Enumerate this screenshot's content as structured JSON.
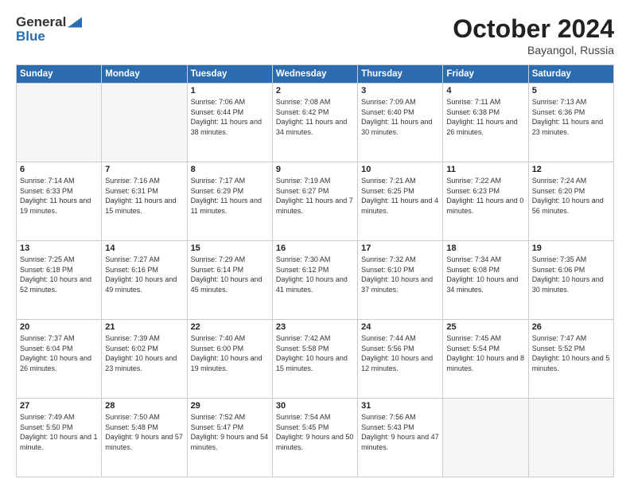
{
  "header": {
    "logo_general": "General",
    "logo_blue": "Blue",
    "month_title": "October 2024",
    "location": "Bayangol, Russia"
  },
  "days_of_week": [
    "Sunday",
    "Monday",
    "Tuesday",
    "Wednesday",
    "Thursday",
    "Friday",
    "Saturday"
  ],
  "weeks": [
    [
      {
        "day": "",
        "empty": true
      },
      {
        "day": "",
        "empty": true
      },
      {
        "day": "1",
        "sunrise": "Sunrise: 7:06 AM",
        "sunset": "Sunset: 6:44 PM",
        "daylight": "Daylight: 11 hours and 38 minutes."
      },
      {
        "day": "2",
        "sunrise": "Sunrise: 7:08 AM",
        "sunset": "Sunset: 6:42 PM",
        "daylight": "Daylight: 11 hours and 34 minutes."
      },
      {
        "day": "3",
        "sunrise": "Sunrise: 7:09 AM",
        "sunset": "Sunset: 6:40 PM",
        "daylight": "Daylight: 11 hours and 30 minutes."
      },
      {
        "day": "4",
        "sunrise": "Sunrise: 7:11 AM",
        "sunset": "Sunset: 6:38 PM",
        "daylight": "Daylight: 11 hours and 26 minutes."
      },
      {
        "day": "5",
        "sunrise": "Sunrise: 7:13 AM",
        "sunset": "Sunset: 6:36 PM",
        "daylight": "Daylight: 11 hours and 23 minutes."
      }
    ],
    [
      {
        "day": "6",
        "sunrise": "Sunrise: 7:14 AM",
        "sunset": "Sunset: 6:33 PM",
        "daylight": "Daylight: 11 hours and 19 minutes."
      },
      {
        "day": "7",
        "sunrise": "Sunrise: 7:16 AM",
        "sunset": "Sunset: 6:31 PM",
        "daylight": "Daylight: 11 hours and 15 minutes."
      },
      {
        "day": "8",
        "sunrise": "Sunrise: 7:17 AM",
        "sunset": "Sunset: 6:29 PM",
        "daylight": "Daylight: 11 hours and 11 minutes."
      },
      {
        "day": "9",
        "sunrise": "Sunrise: 7:19 AM",
        "sunset": "Sunset: 6:27 PM",
        "daylight": "Daylight: 11 hours and 7 minutes."
      },
      {
        "day": "10",
        "sunrise": "Sunrise: 7:21 AM",
        "sunset": "Sunset: 6:25 PM",
        "daylight": "Daylight: 11 hours and 4 minutes."
      },
      {
        "day": "11",
        "sunrise": "Sunrise: 7:22 AM",
        "sunset": "Sunset: 6:23 PM",
        "daylight": "Daylight: 11 hours and 0 minutes."
      },
      {
        "day": "12",
        "sunrise": "Sunrise: 7:24 AM",
        "sunset": "Sunset: 6:20 PM",
        "daylight": "Daylight: 10 hours and 56 minutes."
      }
    ],
    [
      {
        "day": "13",
        "sunrise": "Sunrise: 7:25 AM",
        "sunset": "Sunset: 6:18 PM",
        "daylight": "Daylight: 10 hours and 52 minutes."
      },
      {
        "day": "14",
        "sunrise": "Sunrise: 7:27 AM",
        "sunset": "Sunset: 6:16 PM",
        "daylight": "Daylight: 10 hours and 49 minutes."
      },
      {
        "day": "15",
        "sunrise": "Sunrise: 7:29 AM",
        "sunset": "Sunset: 6:14 PM",
        "daylight": "Daylight: 10 hours and 45 minutes."
      },
      {
        "day": "16",
        "sunrise": "Sunrise: 7:30 AM",
        "sunset": "Sunset: 6:12 PM",
        "daylight": "Daylight: 10 hours and 41 minutes."
      },
      {
        "day": "17",
        "sunrise": "Sunrise: 7:32 AM",
        "sunset": "Sunset: 6:10 PM",
        "daylight": "Daylight: 10 hours and 37 minutes."
      },
      {
        "day": "18",
        "sunrise": "Sunrise: 7:34 AM",
        "sunset": "Sunset: 6:08 PM",
        "daylight": "Daylight: 10 hours and 34 minutes."
      },
      {
        "day": "19",
        "sunrise": "Sunrise: 7:35 AM",
        "sunset": "Sunset: 6:06 PM",
        "daylight": "Daylight: 10 hours and 30 minutes."
      }
    ],
    [
      {
        "day": "20",
        "sunrise": "Sunrise: 7:37 AM",
        "sunset": "Sunset: 6:04 PM",
        "daylight": "Daylight: 10 hours and 26 minutes."
      },
      {
        "day": "21",
        "sunrise": "Sunrise: 7:39 AM",
        "sunset": "Sunset: 6:02 PM",
        "daylight": "Daylight: 10 hours and 23 minutes."
      },
      {
        "day": "22",
        "sunrise": "Sunrise: 7:40 AM",
        "sunset": "Sunset: 6:00 PM",
        "daylight": "Daylight: 10 hours and 19 minutes."
      },
      {
        "day": "23",
        "sunrise": "Sunrise: 7:42 AM",
        "sunset": "Sunset: 5:58 PM",
        "daylight": "Daylight: 10 hours and 15 minutes."
      },
      {
        "day": "24",
        "sunrise": "Sunrise: 7:44 AM",
        "sunset": "Sunset: 5:56 PM",
        "daylight": "Daylight: 10 hours and 12 minutes."
      },
      {
        "day": "25",
        "sunrise": "Sunrise: 7:45 AM",
        "sunset": "Sunset: 5:54 PM",
        "daylight": "Daylight: 10 hours and 8 minutes."
      },
      {
        "day": "26",
        "sunrise": "Sunrise: 7:47 AM",
        "sunset": "Sunset: 5:52 PM",
        "daylight": "Daylight: 10 hours and 5 minutes."
      }
    ],
    [
      {
        "day": "27",
        "sunrise": "Sunrise: 7:49 AM",
        "sunset": "Sunset: 5:50 PM",
        "daylight": "Daylight: 10 hours and 1 minute."
      },
      {
        "day": "28",
        "sunrise": "Sunrise: 7:50 AM",
        "sunset": "Sunset: 5:48 PM",
        "daylight": "Daylight: 9 hours and 57 minutes."
      },
      {
        "day": "29",
        "sunrise": "Sunrise: 7:52 AM",
        "sunset": "Sunset: 5:47 PM",
        "daylight": "Daylight: 9 hours and 54 minutes."
      },
      {
        "day": "30",
        "sunrise": "Sunrise: 7:54 AM",
        "sunset": "Sunset: 5:45 PM",
        "daylight": "Daylight: 9 hours and 50 minutes."
      },
      {
        "day": "31",
        "sunrise": "Sunrise: 7:56 AM",
        "sunset": "Sunset: 5:43 PM",
        "daylight": "Daylight: 9 hours and 47 minutes."
      },
      {
        "day": "",
        "empty": true
      },
      {
        "day": "",
        "empty": true
      }
    ]
  ]
}
